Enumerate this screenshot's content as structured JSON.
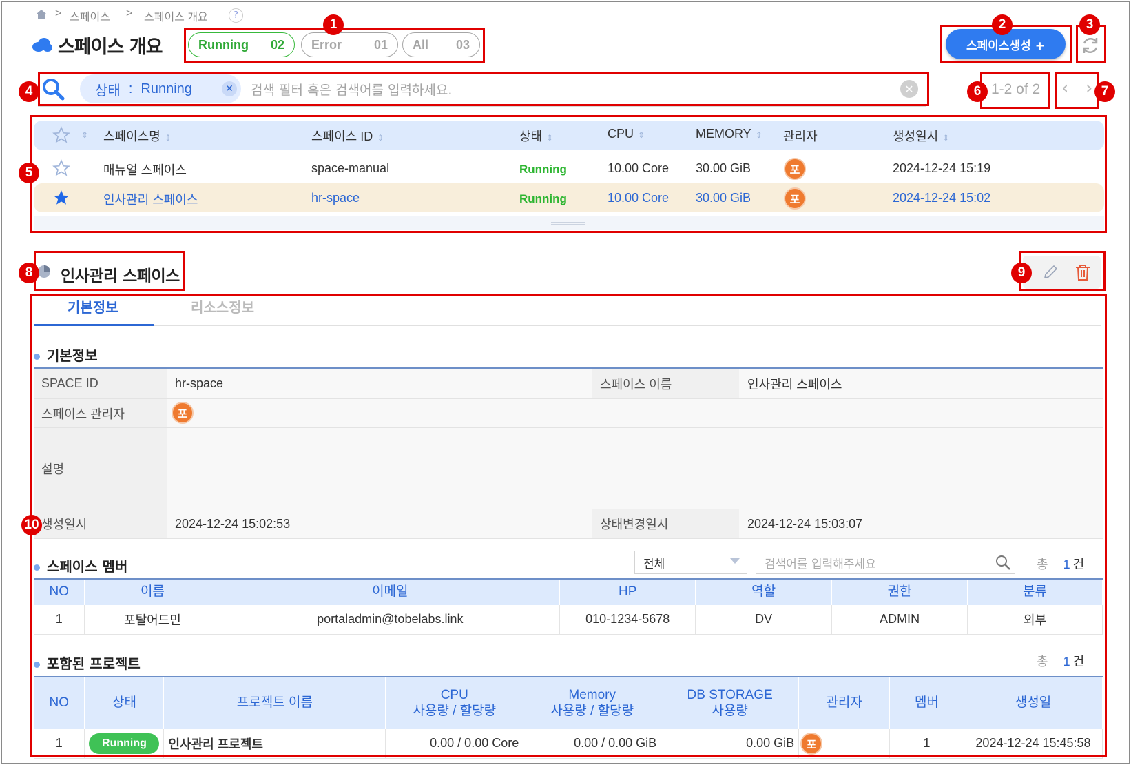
{
  "breadcrumb": {
    "items": [
      "스페이스",
      "스페이스 개요"
    ],
    "help": "?"
  },
  "header": {
    "title": "스페이스 개요",
    "create_label": "스페이스생성 +"
  },
  "status_filters": [
    {
      "label": "Running",
      "count": "02"
    },
    {
      "label": "Error",
      "count": "01"
    },
    {
      "label": "All",
      "count": "03"
    }
  ],
  "search": {
    "chip_key": "상태",
    "chip_sep": ":",
    "chip_value": "Running",
    "placeholder": "검색 필터 혹은 검색어를 입력하세요."
  },
  "pager": {
    "label": "1-2 of 2"
  },
  "space_table": {
    "columns": [
      "스페이스명",
      "스페이스 ID",
      "상태",
      "CPU",
      "MEMORY",
      "관리자",
      "생성일시"
    ],
    "rows": [
      {
        "name": "매뉴얼 스페이스",
        "id": "space-manual",
        "status": "Running",
        "cpu": "10.00 Core",
        "memory": "30.00 GiB",
        "admin": "포",
        "created": "2024-12-24 15:19",
        "favorite": false
      },
      {
        "name": "인사관리 스페이스",
        "id": "hr-space",
        "status": "Running",
        "cpu": "10.00 Core",
        "memory": "30.00 GiB",
        "admin": "포",
        "created": "2024-12-24 15:02",
        "favorite": true
      }
    ]
  },
  "detail": {
    "title": "인사관리 스페이스",
    "tabs": [
      "기본정보",
      "리소스정보"
    ],
    "basic_section": "기본정보",
    "fields": {
      "space_id_label": "SPACE ID",
      "space_id": "hr-space",
      "space_name_label": "스페이스 이름",
      "space_name": "인사관리 스페이스",
      "admin_label": "스페이스 관리자",
      "admin": "포",
      "desc_label": "설명",
      "created_label": "생성일시",
      "created": "2024-12-24 15:02:53",
      "status_changed_label": "상태변경일시",
      "status_changed": "2024-12-24 15:03:07"
    },
    "members": {
      "title": "스페이스 멤버",
      "filter_value": "전체",
      "search_placeholder": "검색어를 입력해주세요",
      "total_label": "총",
      "total": "1",
      "unit": "건",
      "columns": [
        "NO",
        "이름",
        "이메일",
        "HP",
        "역할",
        "권한",
        "분류"
      ],
      "rows": [
        [
          "1",
          "포탈어드민",
          "portaladmin@tobelabs.link",
          "010-1234-5678",
          "DV",
          "ADMIN",
          "외부"
        ]
      ]
    },
    "projects": {
      "title": "포함된 프로젝트",
      "total_label": "총",
      "total": "1",
      "unit": "건",
      "columns": [
        "NO",
        "상태",
        "프로젝트 이름",
        "CPU\n사용량 / 할당량",
        "Memory\n사용량 / 할당량",
        "DB STORAGE\n사용량",
        "관리자",
        "멤버",
        "생성일"
      ],
      "rows": [
        {
          "no": "1",
          "status": "Running",
          "name": "인사관리 프로젝트",
          "cpu": "0.00 / 0.00 Core",
          "memory": "0.00 / 0.00 GiB",
          "db": "0.00 GiB",
          "admin": "포",
          "members": "1",
          "created": "2024-12-24 15:45:58"
        }
      ]
    }
  },
  "annotations": [
    "1",
    "2",
    "3",
    "4",
    "5",
    "6",
    "7",
    "8",
    "9",
    "10"
  ]
}
